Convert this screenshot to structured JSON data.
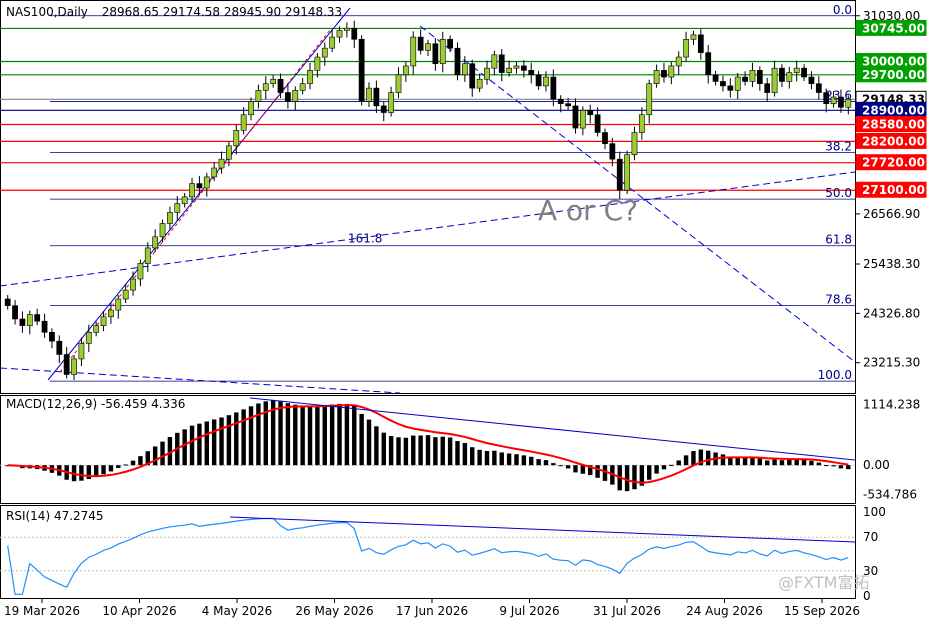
{
  "header": {
    "symbol": "NAS100,Daily",
    "ohlc": "28968.65 29174.58 28945.90 29148.33"
  },
  "watermark": "A or C?",
  "brand": "@FXTM富拓",
  "colors": {
    "bull": "#9acd32",
    "bear": "#000000",
    "macd_hist": "#000000",
    "macd_signal": "#ff0000",
    "rsi_line": "#1e90ff",
    "trend": "#0000cd",
    "support": "#ff0000",
    "resistance": "#008000",
    "current_price": "#000080"
  },
  "chart_data": [
    {
      "type": "candlestick",
      "title": "NAS100,Daily",
      "ylim": [
        22600,
        31250
      ],
      "y_ticks": [
        "31030.00",
        "26566.90",
        "25438.30",
        "24326.80",
        "23215.30"
      ],
      "x_tick_labels": [
        "19 Mar 2026",
        "10 Apr 2026",
        "4 May 2026",
        "26 May 2026",
        "17 Jun 2026",
        "9 Jul 2026",
        "31 Jul 2026",
        "24 Aug 2026",
        "15 Sep 2026"
      ],
      "price_labels": [
        {
          "value": 30745,
          "label": "30745.00",
          "kind": "resistance"
        },
        {
          "value": 30000,
          "label": "30000.00",
          "kind": "resistance"
        },
        {
          "value": 29700,
          "label": "29700.00",
          "kind": "resistance"
        },
        {
          "value": 29148.33,
          "label": "29148.33",
          "kind": "current"
        },
        {
          "value": 28900,
          "label": "28900.00",
          "kind": "pivot"
        },
        {
          "value": 28580,
          "label": "28580.00",
          "kind": "support"
        },
        {
          "value": 28200,
          "label": "28200.00",
          "kind": "support"
        },
        {
          "value": 27720,
          "label": "27720.00",
          "kind": "support"
        },
        {
          "value": 27100,
          "label": "27100.00",
          "kind": "support"
        }
      ],
      "fib_levels": [
        {
          "label": "0.0",
          "value": 31030
        },
        {
          "label": "23.6",
          "value": 29100
        },
        {
          "label": "38.2",
          "value": 27950
        },
        {
          "label": "50.0",
          "value": 26900
        },
        {
          "label": "61.8",
          "value": 25850
        },
        {
          "label": "78.6",
          "value": 24500
        },
        {
          "label": "100.0",
          "value": 22800
        }
      ],
      "fib_extension": {
        "label": "161.8",
        "value": 25850
      },
      "closes": [
        24500,
        24200,
        24050,
        24300,
        24150,
        23900,
        23700,
        23400,
        22950,
        23300,
        23650,
        23900,
        24050,
        24250,
        24400,
        24650,
        24850,
        25100,
        25450,
        25800,
        26050,
        26350,
        26600,
        26800,
        26950,
        27250,
        27150,
        27400,
        27600,
        27800,
        28100,
        28450,
        28800,
        29100,
        29350,
        29500,
        29600,
        29300,
        29100,
        29350,
        29500,
        29800,
        30100,
        30300,
        30550,
        30700,
        30750,
        30500,
        29100,
        29400,
        29000,
        28850,
        29300,
        29700,
        29900,
        30550,
        30250,
        30400,
        29950,
        30500,
        30300,
        29700,
        29950,
        29400,
        29600,
        29850,
        30150,
        29750,
        29850,
        29900,
        29800,
        29700,
        29450,
        29650,
        29150,
        29050,
        29000,
        28500,
        28900,
        28800,
        28400,
        28150,
        27800,
        27100,
        27900,
        28400,
        28800,
        29500,
        29800,
        29650,
        29900,
        30100,
        30500,
        30600,
        30200,
        29700,
        29550,
        29450,
        29350,
        29650,
        29550,
        29800,
        29500,
        29300,
        29850,
        29550,
        29750,
        29850,
        29650,
        29500,
        29300,
        29050,
        29200,
        28968,
        29148
      ]
    },
    {
      "type": "bar+line",
      "title": "MACD(12,26,9) -56.459 4.336",
      "label": "MACD(12,26,9)",
      "values_text": "-56.459 4.336",
      "y_ticks": [
        "1114.238",
        "0.00",
        "-534.786"
      ],
      "ylim": [
        -640,
        1200
      ]
    },
    {
      "type": "line",
      "title": "RSI(14) 47.2745",
      "label": "RSI(14)",
      "values_text": "47.2745",
      "y_ticks": [
        "100",
        "70",
        "30",
        "0"
      ],
      "ylim": [
        0,
        100
      ]
    }
  ]
}
